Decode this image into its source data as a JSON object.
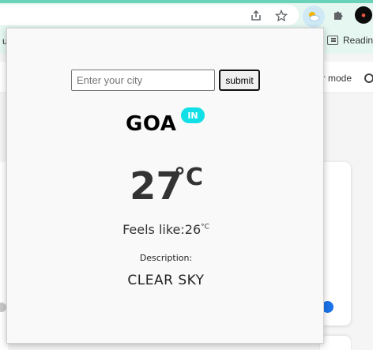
{
  "browser": {
    "bookmark_left_text": "u",
    "bookmark_right_text": "Readin",
    "icons": [
      "share-icon",
      "star-icon",
      "weather-extension-icon",
      "puzzle-icon",
      "profile-avatar"
    ]
  },
  "page": {
    "mode_text": "er mode"
  },
  "popup": {
    "search": {
      "placeholder": "Enter your city",
      "value": "",
      "submit_label": "submit"
    },
    "city": "GOA",
    "country_code": "IN",
    "temperature": "27",
    "temperature_unit": "°C",
    "feels_like_label": "Feels like:",
    "feels_like_value": "26",
    "feels_like_unit": "°C",
    "description_label": "Description:",
    "description_value": "CLEAR SKY"
  },
  "colors": {
    "badge": "#11e0e6",
    "toolbar": "#e6f7f1",
    "accent_dot": "#1a73e8"
  }
}
